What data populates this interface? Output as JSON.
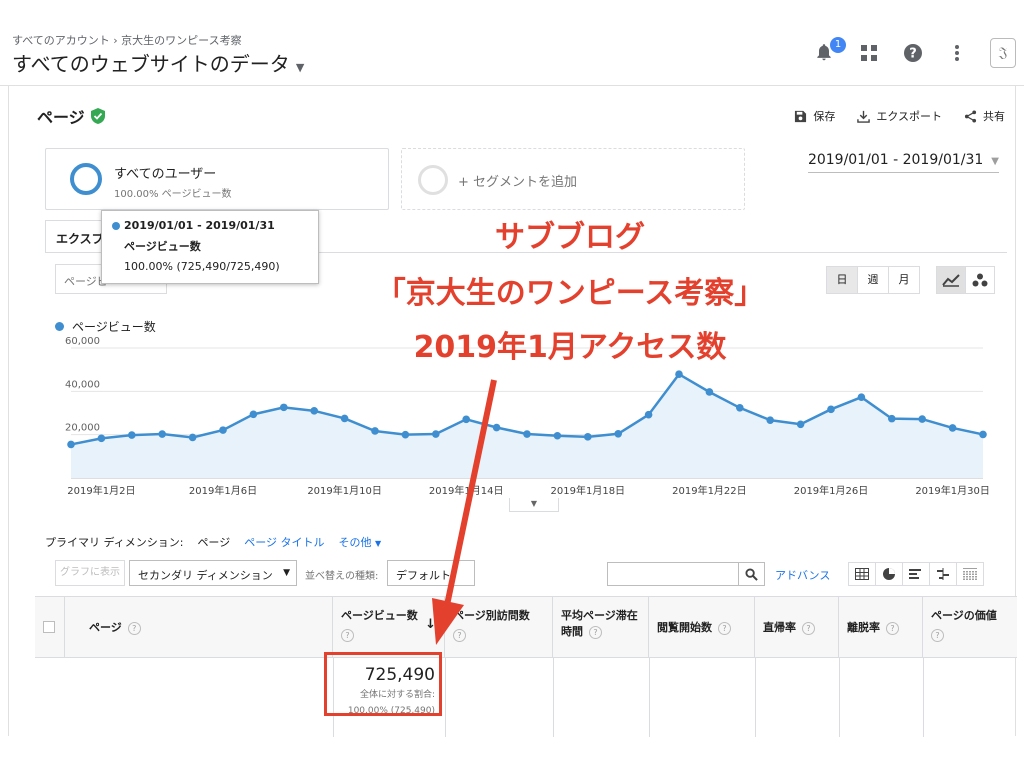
{
  "header": {
    "breadcrumb": "すべてのアカウント › 京大生のワンピース考察",
    "property_title": "すべてのウェブサイトのデータ",
    "notifications_count": "1",
    "avatar_glyph": "𝔍"
  },
  "report": {
    "title": "ページ",
    "actions": {
      "save": "保存",
      "export": "エクスポート",
      "share": "共有"
    },
    "date_range": "2019/01/01 - 2019/01/31",
    "segment": {
      "name": "すべてのユーザー",
      "sub": "100.00% ページビュー数"
    },
    "add_segment": "+ セグメントを追加",
    "tab_explorer": "エクスプ",
    "metric_select": "ページビ",
    "granularity": {
      "day": "日",
      "week": "週",
      "month": "月"
    }
  },
  "tooltip": {
    "date": "2019/01/01 - 2019/01/31",
    "metric": "ページビュー数",
    "value": "100.00% (725,490/725,490)"
  },
  "chart_data": {
    "type": "area",
    "legend": "ページビュー数",
    "ylim": [
      0,
      60000
    ],
    "yticks": [
      "60,000",
      "40,000",
      "20,000"
    ],
    "ytick_values": [
      60000,
      40000,
      20000
    ],
    "x_tick_labels": [
      "2019年1月2日",
      "2019年1月6日",
      "2019年1月10日",
      "2019年1月14日",
      "2019年1月18日",
      "2019年1月22日",
      "2019年1月26日",
      "2019年1月30日"
    ],
    "x_tick_days": [
      2,
      6,
      10,
      14,
      18,
      22,
      26,
      30
    ],
    "x": [
      1,
      2,
      3,
      4,
      5,
      6,
      7,
      8,
      9,
      10,
      11,
      12,
      13,
      14,
      15,
      16,
      17,
      18,
      19,
      20,
      21,
      22,
      23,
      24,
      25,
      26,
      27,
      28,
      29,
      30,
      31
    ],
    "values": [
      15500,
      18300,
      19800,
      20300,
      18700,
      22100,
      29400,
      32600,
      31000,
      27500,
      21700,
      20000,
      20300,
      27100,
      23300,
      20300,
      19500,
      19000,
      20400,
      29200,
      47900,
      39700,
      32400,
      26700,
      24800,
      31700,
      37300,
      27400,
      27200,
      23100,
      20100
    ],
    "color": "#3e8ed0",
    "fill": "#e8f2fb"
  },
  "dimension_bar": {
    "label": "プライマリ ディメンション:",
    "current": "ページ",
    "option_title": "ページ タイトル",
    "option_other": "その他"
  },
  "tools": {
    "plot_rows": "グラフに表示",
    "secondary_dimension": "セカンダリ ディメンション",
    "sort_label": "並べ替えの種類:",
    "sort_value": "デフォルト",
    "advanced": "アドバンス"
  },
  "table": {
    "headers": {
      "page": "ページ",
      "pageviews": "ページビュー数",
      "unique_pageviews": "ページ別訪問数",
      "avg_time": "平均ページ滞在時間",
      "entrances": "閲覧開始数",
      "bounce_rate": "直帰率",
      "exit_rate": "離脱率",
      "page_value": "ページの価値"
    },
    "totals": {
      "pageviews": "725,490",
      "pageviews_sub1": "全体に対する割合:",
      "pageviews_sub2": "100.00% (725,490)"
    }
  },
  "annotation": {
    "line1": "サブブログ",
    "line2": "「京大生のワンピース考察」",
    "line3": "2019年1月アクセス数",
    "color": "#e3412d"
  }
}
